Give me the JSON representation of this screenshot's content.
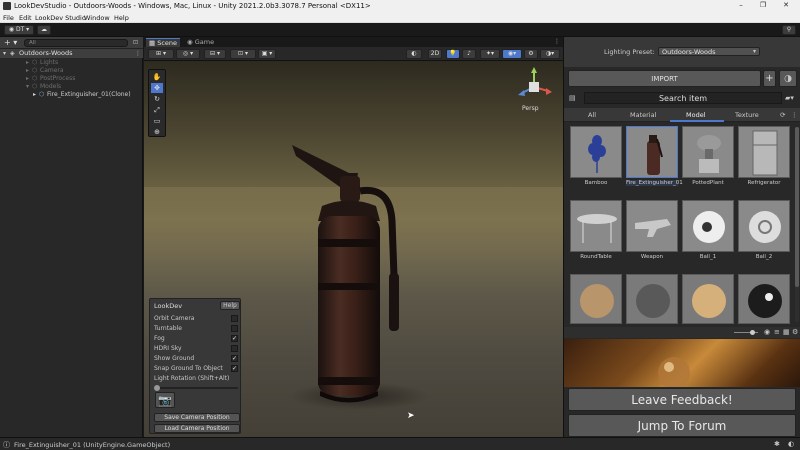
{
  "window": {
    "title": "LookDevStudio - Outdoors-Woods - Windows, Mac, Linux - Unity 2021.2.0b3.3078.7 Personal <DX11>",
    "minimize": "–",
    "maximize": "❐",
    "close": "✕"
  },
  "menu": [
    "File",
    "Edit",
    "LookDev Studio",
    "Window",
    "Help"
  ],
  "toolbar": {
    "account": "DT",
    "cloud_icon": "cloud-icon",
    "search_icon": "search-icon"
  },
  "hierarchy": {
    "search_placeholder": "All",
    "scene": "Outdoors-Woods",
    "items": [
      {
        "label": "Lights",
        "depth": 1,
        "dim": true
      },
      {
        "label": "Camera",
        "depth": 1,
        "dim": true
      },
      {
        "label": "PostProcess",
        "depth": 1,
        "dim": true
      },
      {
        "label": "Models",
        "depth": 1,
        "dim": true
      },
      {
        "label": "Fire_Extinguisher_01(Clone)",
        "depth": 2,
        "dim": false
      }
    ]
  },
  "scene_tabs": {
    "scene": "Scene",
    "game": "Game"
  },
  "scene_toolbar": {
    "mode_2d": "2D",
    "persp": "Persp"
  },
  "lookdev": {
    "title": "LookDev",
    "help": "Help",
    "options": [
      {
        "label": "Orbit Camera",
        "checked": false
      },
      {
        "label": "Turntable",
        "checked": false
      },
      {
        "label": "Fog",
        "checked": true
      },
      {
        "label": "HDRI Sky",
        "checked": false
      },
      {
        "label": "Show Ground",
        "checked": true
      },
      {
        "label": "Snap Ground To Object",
        "checked": true
      }
    ],
    "rotation_label": "Light Rotation (Shift+Alt)",
    "save_camera": "Save Camera Position",
    "load_camera": "Load Camera Position"
  },
  "right_panel": {
    "lighting_preset_label": "Lighting Preset:",
    "lighting_preset_value": "Outdoors-Woods",
    "import_label": "IMPORT",
    "add": "+",
    "search_placeholder": "Search item",
    "tabs": [
      "All",
      "Material",
      "Model",
      "Texture"
    ],
    "active_tab": "Model",
    "assets": [
      {
        "label": "Bamboo"
      },
      {
        "label": "Fire_Extinguisher_01"
      },
      {
        "label": "PottedPlant"
      },
      {
        "label": "Refrigerator"
      },
      {
        "label": "RoundTable"
      },
      {
        "label": "Weapon"
      },
      {
        "label": "Ball_1"
      },
      {
        "label": "Ball_2"
      },
      {
        "label": ""
      },
      {
        "label": ""
      },
      {
        "label": ""
      },
      {
        "label": ""
      }
    ],
    "feedback": "Leave Feedback!",
    "forum": "Jump To Forum"
  },
  "status": {
    "message": "Fire_Extinguisher_01 (UnityEngine.GameObject)"
  },
  "colors": {
    "accent": "#4d78cc",
    "background": "#282828"
  }
}
